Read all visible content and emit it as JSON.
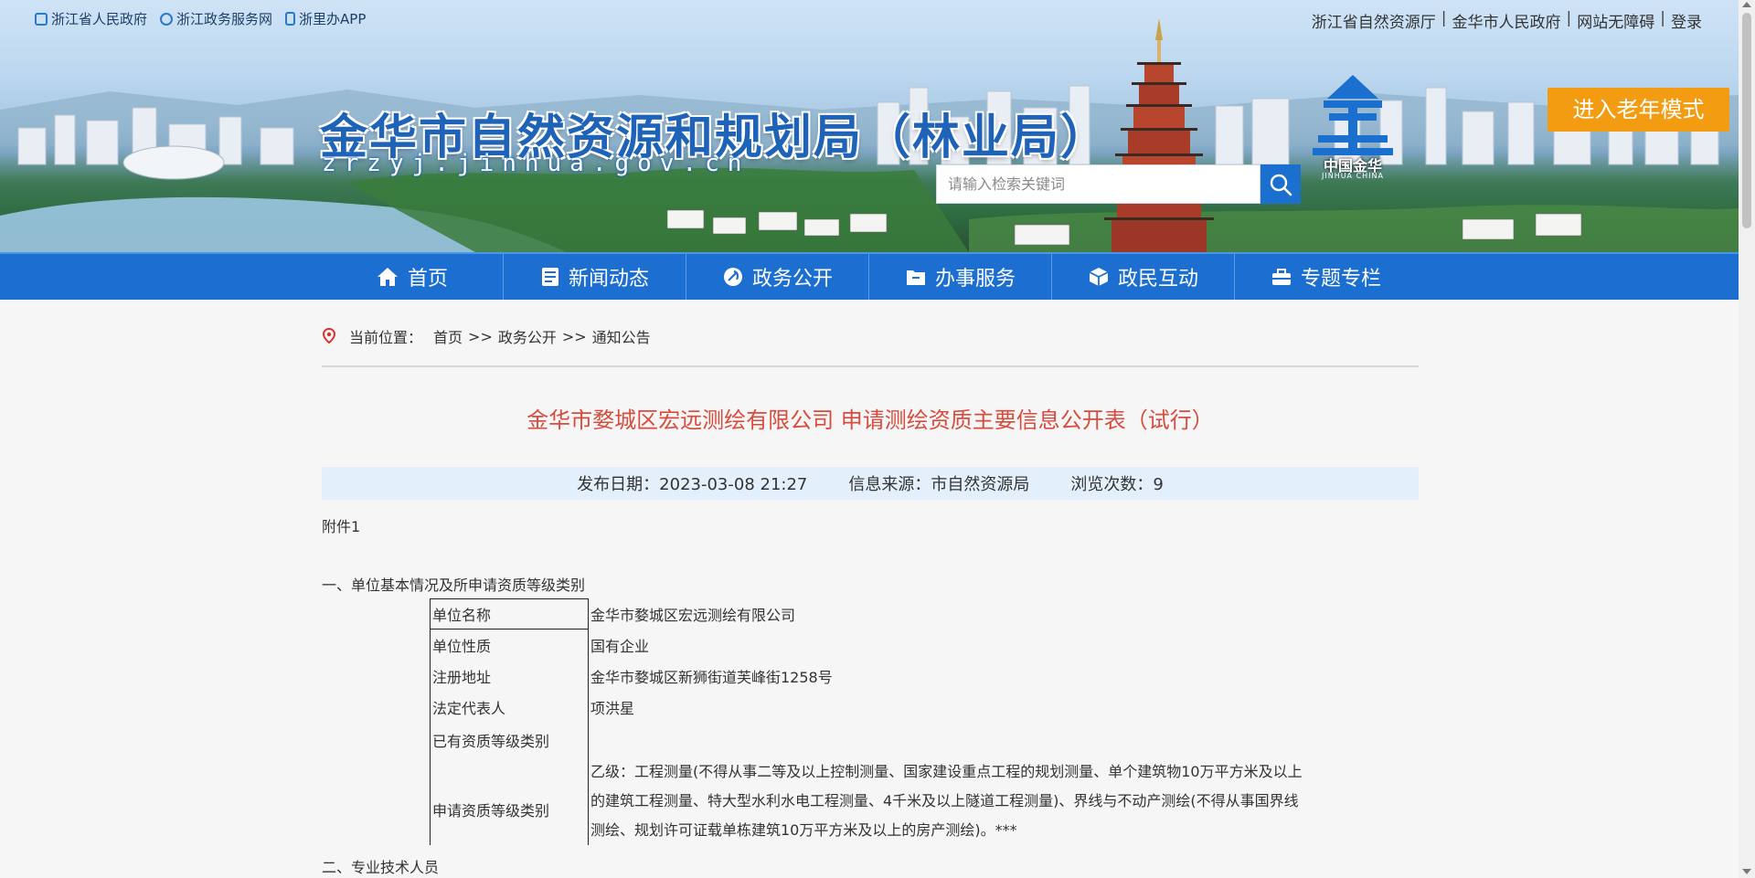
{
  "top_links": {
    "left": [
      {
        "label": "浙江省人民政府",
        "icon": "emblem-icon"
      },
      {
        "label": "浙江政务服务网",
        "icon": "service-icon"
      },
      {
        "label": "浙里办APP",
        "icon": "phone-icon"
      }
    ],
    "right": [
      "浙江省自然资源厅",
      "金华市人民政府",
      "网站无障碍",
      "登录"
    ],
    "separator": "|"
  },
  "header": {
    "title": "金华市自然资源和规划局（林业局）",
    "domain": "zrzyj.jinhua.gov.cn",
    "elder_mode": "进入老年模式",
    "logo_text": "中国金华",
    "logo_sub": "JINHUA CHINA"
  },
  "search": {
    "placeholder": "请输入检索关键词"
  },
  "nav": [
    {
      "label": "首页",
      "icon": "home-icon"
    },
    {
      "label": "新闻动态",
      "icon": "news-icon"
    },
    {
      "label": "政务公开",
      "icon": "party-emblem-icon"
    },
    {
      "label": "办事服务",
      "icon": "folder-icon"
    },
    {
      "label": "政民互动",
      "icon": "cube-icon"
    },
    {
      "label": "专题专栏",
      "icon": "briefcase-icon"
    }
  ],
  "breadcrumb": {
    "prefix": "当前位置：",
    "items": [
      "首页",
      ">>",
      "政务公开",
      ">>",
      "通知公告"
    ]
  },
  "article": {
    "title": "金华市婺城区宏远测绘有限公司 申请测绘资质主要信息公开表（试行）",
    "meta": {
      "date": "发布日期：2023-03-08 21:27",
      "source": "信息来源：市自然资源局",
      "views": "浏览次数：9"
    },
    "attachment": "附件1",
    "section1": "一、单位基本情况及所申请资质等级类别",
    "rows": [
      {
        "key": "单位名称",
        "value": "金华市婺城区宏远测绘有限公司"
      },
      {
        "key": "单位性质",
        "value": "国有企业"
      },
      {
        "key": "注册地址",
        "value": "金华市婺城区新狮街道芙峰街1258号"
      },
      {
        "key": "法定代表人",
        "value": "项洪星"
      },
      {
        "key": "已有资质等级类别",
        "value": ""
      },
      {
        "key": "申请资质等级类别",
        "value_lines": [
          "乙级：工程测量(不得从事二等及以上控制测量、国家建设重点工程的规划测量、单个建筑物10万平方米及以上",
          "的建筑工程测量、特大型水利水电工程测量、4千米及以上隧道工程测量)、界线与不动产测绘(不得从事国界线",
          "测绘、规划许可证载单栋建筑10万平方米及以上的房产测绘)。***"
        ]
      }
    ],
    "section2": "二、专业技术人员"
  }
}
